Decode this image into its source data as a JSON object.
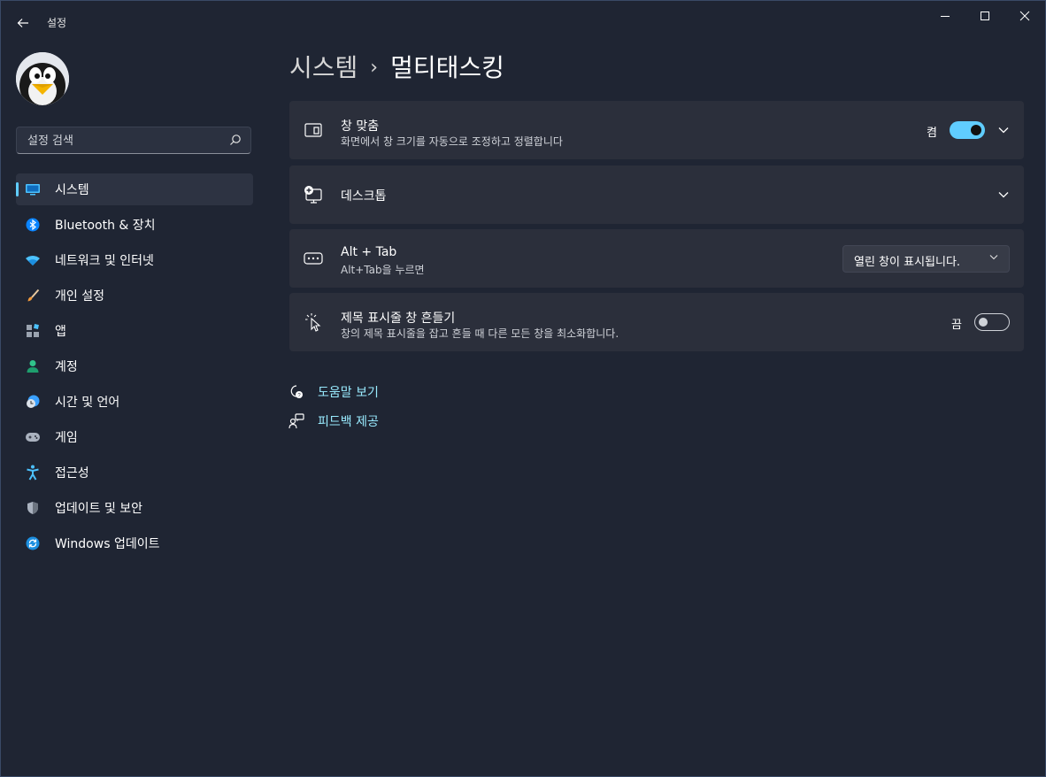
{
  "window": {
    "title": "설정"
  },
  "search": {
    "placeholder": "설정 검색"
  },
  "sidebar": {
    "items": [
      {
        "label": "시스템",
        "icon": "monitor-icon",
        "active": true
      },
      {
        "label": "Bluetooth & 장치",
        "icon": "bluetooth-icon"
      },
      {
        "label": "네트워크 및 인터넷",
        "icon": "wifi-icon"
      },
      {
        "label": "개인 설정",
        "icon": "paintbrush-icon"
      },
      {
        "label": "앱",
        "icon": "apps-icon"
      },
      {
        "label": "계정",
        "icon": "person-icon"
      },
      {
        "label": "시간 및 언어",
        "icon": "globe-clock-icon"
      },
      {
        "label": "게임",
        "icon": "gamepad-icon"
      },
      {
        "label": "접근성",
        "icon": "accessibility-icon"
      },
      {
        "label": "업데이트 및 보안",
        "icon": "shield-icon"
      },
      {
        "label": "Windows 업데이트",
        "icon": "refresh-icon"
      }
    ]
  },
  "breadcrumb": {
    "parent": "시스템",
    "separator": "›",
    "current": "멀티태스킹"
  },
  "settings": {
    "snap": {
      "title": "창 맞춤",
      "description": "화면에서 창 크기를 자동으로 조정하고 정렬합니다",
      "state_label": "켬",
      "enabled": true,
      "icon": "snap-layout-icon"
    },
    "desktops": {
      "title": "데스크톱",
      "icon": "desktop-add-icon"
    },
    "alt_tab": {
      "title": "Alt + Tab",
      "description": "Alt+Tab을 누르면",
      "selected": "열린 창이 표시됩니다.",
      "icon": "keyboard-icon"
    },
    "title_bar_shake": {
      "title": "제목 표시줄 창 흔들기",
      "description": "창의 제목 표시줄을 잡고 흔들 때 다른 모든 창을 최소화합니다.",
      "state_label": "끔",
      "enabled": false,
      "icon": "shake-cursor-icon"
    }
  },
  "links": {
    "help": "도움말 보기",
    "feedback": "피드백 제공"
  },
  "colors": {
    "accent": "#60cdff",
    "link": "#99ebff",
    "card": "#2b2f3b",
    "background": "#1f2533"
  }
}
